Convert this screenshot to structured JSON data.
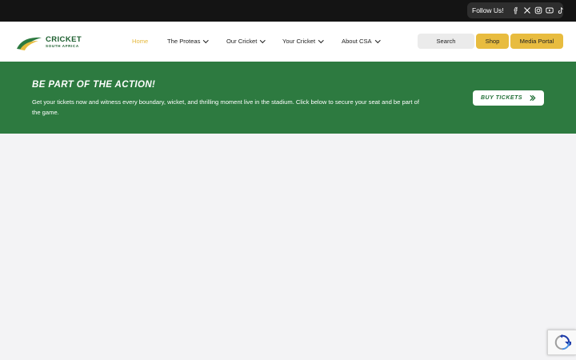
{
  "topbar": {
    "follow_label": "Follow Us!",
    "social_icons": [
      "facebook-icon",
      "x-twitter-icon",
      "instagram-icon",
      "youtube-icon",
      "tiktok-icon"
    ]
  },
  "header": {
    "logo": {
      "main": "CRICKET",
      "sub": "SOUTH AFRICA"
    },
    "nav": [
      {
        "label": "Home",
        "active": true,
        "dropdown": false
      },
      {
        "label": "The Proteas",
        "dropdown": true
      },
      {
        "label": "Our Cricket",
        "dropdown": true
      },
      {
        "label": "Your Cricket",
        "dropdown": true
      },
      {
        "label": "About CSA",
        "dropdown": true
      }
    ],
    "search_label": "Search",
    "shop_label": "Shop",
    "media_label": "Media Portal"
  },
  "banner": {
    "title": "BE PART OF THE ACTION!",
    "text": "Get your tickets now and witness every boundary, wicket, and thrilling moment live in the stadium. Click below to secure your seat and be part of the game.",
    "button_label": "BUY TICKETS"
  },
  "colors": {
    "topbar": "#141414",
    "brand_green": "#2d7a40",
    "accent_yellow": "#e8bc3f",
    "active_nav": "#e5b93e",
    "page_bg": "#f3f3f5"
  }
}
